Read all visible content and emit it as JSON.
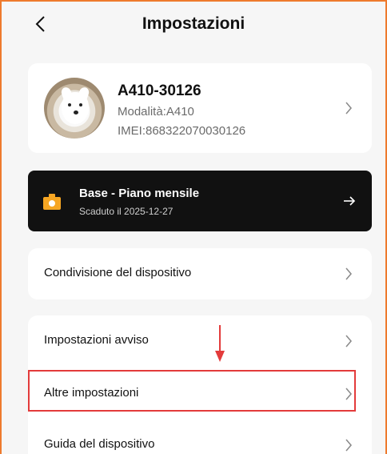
{
  "header": {
    "title": "Impostazioni"
  },
  "device": {
    "name": "A410-30126",
    "mode": "Modalità:A410",
    "imei": "IMEI:868322070030126"
  },
  "plan": {
    "title": "Base - Piano mensile",
    "expiry": "Scaduto il 2025-12-27"
  },
  "menu": {
    "share": "Condivisione del dispositivo",
    "alerts": "Impostazioni avviso",
    "other": "Altre impostazioni",
    "guide": "Guida del dispositivo"
  },
  "colors": {
    "accent_border": "#ee7a2d",
    "highlight": "#e33b3b",
    "plan_icon": "#f6a623",
    "plan_bg": "#111111"
  },
  "icons": {
    "back": "chevron-left-icon",
    "row": "chevron-right-icon",
    "plan": "camera-icon",
    "plan_action": "arrow-right-icon",
    "annotation": "down-arrow-icon"
  }
}
